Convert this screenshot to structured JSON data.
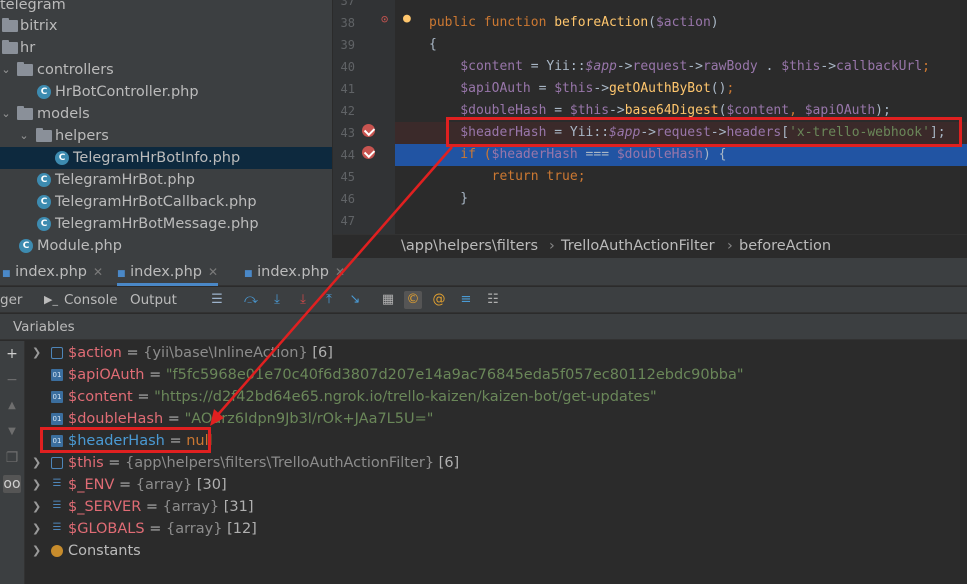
{
  "tree": {
    "items": [
      {
        "label": "telegram",
        "kind": "folder",
        "expanded": true
      },
      {
        "label": "bitrix",
        "kind": "folder",
        "expanded": false
      },
      {
        "label": "hr",
        "kind": "folder",
        "expanded": false
      },
      {
        "label": "controllers",
        "kind": "folder",
        "expanded": true
      },
      {
        "label": "HrBotController.php",
        "kind": "class"
      },
      {
        "label": "models",
        "kind": "folder",
        "expanded": true
      },
      {
        "label": "helpers",
        "kind": "folder",
        "expanded": true
      },
      {
        "label": "TelegramHrBotInfo.php",
        "kind": "class",
        "selected": true
      },
      {
        "label": "TelegramHrBot.php",
        "kind": "class"
      },
      {
        "label": "TelegramHrBotCallback.php",
        "kind": "class"
      },
      {
        "label": "TelegramHrBotMessage.php",
        "kind": "class"
      },
      {
        "label": "Module.php",
        "kind": "class"
      }
    ]
  },
  "editor": {
    "lines": [
      {
        "num": "37",
        "tokens": []
      },
      {
        "num": "38",
        "tokens": [
          {
            "t": "public function ",
            "c": "kw"
          },
          {
            "t": "beforeAction",
            "c": "fn"
          },
          {
            "t": "(",
            "c": "plain"
          },
          {
            "t": "$action",
            "c": "var"
          },
          {
            "t": ")",
            "c": "plain"
          }
        ]
      },
      {
        "num": "39",
        "tokens": [
          {
            "t": "{",
            "c": "plain"
          }
        ]
      },
      {
        "num": "40",
        "tokens": [
          {
            "t": "    $content",
            "c": "var"
          },
          {
            "t": " = Yii::",
            "c": "plain"
          },
          {
            "t": "$app",
            "c": "iv"
          },
          {
            "t": "->",
            "c": "plain"
          },
          {
            "t": "request",
            "c": "var"
          },
          {
            "t": "->",
            "c": "plain"
          },
          {
            "t": "rawBody",
            "c": "var"
          },
          {
            "t": " . ",
            "c": "plain"
          },
          {
            "t": "$this",
            "c": "var"
          },
          {
            "t": "->",
            "c": "plain"
          },
          {
            "t": "callbackUrl",
            "c": "var"
          },
          {
            "t": ";",
            "c": "kw"
          }
        ]
      },
      {
        "num": "41",
        "tokens": [
          {
            "t": "    $apiOAuth",
            "c": "var"
          },
          {
            "t": " = ",
            "c": "plain"
          },
          {
            "t": "$this",
            "c": "var"
          },
          {
            "t": "->",
            "c": "plain"
          },
          {
            "t": "getOAuthByBot",
            "c": "fn"
          },
          {
            "t": "()",
            "c": "plain"
          },
          {
            "t": ";",
            "c": "kw"
          }
        ]
      },
      {
        "num": "42",
        "tokens": [
          {
            "t": "    $doubleHash",
            "c": "var"
          },
          {
            "t": " = ",
            "c": "plain"
          },
          {
            "t": "$this",
            "c": "var"
          },
          {
            "t": "->",
            "c": "plain"
          },
          {
            "t": "base64Digest",
            "c": "fn"
          },
          {
            "t": "(",
            "c": "plain"
          },
          {
            "t": "$content",
            "c": "var"
          },
          {
            "t": ", ",
            "c": "kw"
          },
          {
            "t": "$apiOAuth",
            "c": "var"
          },
          {
            "t": ");",
            "c": "plain"
          }
        ]
      },
      {
        "num": "43",
        "tokens": [
          {
            "t": "    $headerHash",
            "c": "var"
          },
          {
            "t": " = Yii::",
            "c": "plain"
          },
          {
            "t": "$app",
            "c": "iv"
          },
          {
            "t": "->",
            "c": "plain"
          },
          {
            "t": "request",
            "c": "var"
          },
          {
            "t": "->",
            "c": "plain"
          },
          {
            "t": "headers",
            "c": "var"
          },
          {
            "t": "[",
            "c": "plain"
          },
          {
            "t": "'x-trello-webhook'",
            "c": "str"
          },
          {
            "t": "];",
            "c": "plain"
          }
        ]
      },
      {
        "num": "44",
        "tokens": [
          {
            "t": "    if (",
            "c": "kw"
          },
          {
            "t": "$headerHash",
            "c": "var"
          },
          {
            "t": " === ",
            "c": "plain"
          },
          {
            "t": "$doubleHash",
            "c": "var"
          },
          {
            "t": ") {",
            "c": "plain"
          }
        ]
      },
      {
        "num": "45",
        "tokens": [
          {
            "t": "        return true",
            "c": "kw"
          },
          {
            "t": ";",
            "c": "kw"
          }
        ]
      },
      {
        "num": "46",
        "tokens": [
          {
            "t": "    }",
            "c": "plain"
          }
        ]
      },
      {
        "num": "47",
        "tokens": []
      }
    ]
  },
  "breadcrumb": {
    "path": "\\app\\helpers\\filters",
    "class_name": "TrelloAuthActionFilter",
    "method": "beforeAction"
  },
  "tabs": [
    {
      "label": "index.php"
    },
    {
      "label": "index.php"
    },
    {
      "label": "index.php"
    }
  ],
  "debugger": {
    "left_label": "ger",
    "console": "Console",
    "output": "Output"
  },
  "variables": {
    "header": "Variables",
    "rows": [
      {
        "name": "$action",
        "expandable": true,
        "icon": "object-icon",
        "type": "{yii\\base\\InlineAction}",
        "extra": "[6]"
      },
      {
        "name": "$apiOAuth",
        "icon": "string-icon",
        "value": "\"f5fc5968e01e70c40f6d3807d207e14a9ac76845eda5f057ec80112ebdc90bba\""
      },
      {
        "name": "$content",
        "icon": "string-icon",
        "value": "\"https://d2f42bd64e65.ngrok.io/trello-kaizen/kaizen-bot/get-updates\""
      },
      {
        "name": "$doubleHash",
        "icon": "string-icon",
        "value": "\"AOarz6Idpn9Jb3l/rOk+JAa7L5U=\""
      },
      {
        "name": "$headerHash",
        "icon": "string-icon",
        "value": "null",
        "highlighted": true
      },
      {
        "name": "$this",
        "expandable": true,
        "icon": "object-icon",
        "type": "{app\\helpers\\filters\\TrelloAuthActionFilter}",
        "extra": "[6]"
      },
      {
        "name": "$_ENV",
        "expandable": true,
        "icon": "array-icon",
        "type": "{array}",
        "extra": "[30]"
      },
      {
        "name": "$_SERVER",
        "expandable": true,
        "icon": "array-icon",
        "type": "{array}",
        "extra": "[31]"
      },
      {
        "name": "$GLOBALS",
        "expandable": true,
        "icon": "array-icon",
        "type": "{array}",
        "extra": "[12]"
      },
      {
        "name": "Constants",
        "expandable": true,
        "icon": "constants-icon",
        "plain": true
      }
    ]
  },
  "colors": {
    "highlight_red": "#e02020",
    "selection_blue": "#2154a3",
    "string_green": "#6a8759",
    "keyword_orange": "#cc7832"
  }
}
